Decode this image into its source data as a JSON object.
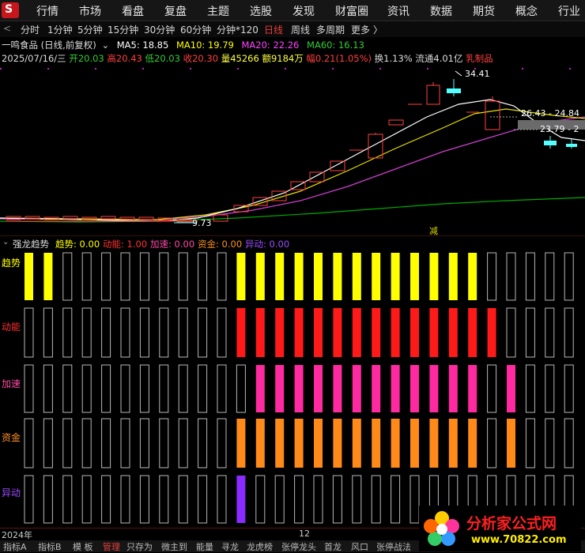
{
  "menu": [
    "行情",
    "市场",
    "看盘",
    "复盘",
    "主题",
    "选股",
    "发现",
    "财富圈",
    "资讯",
    "数据",
    "期货",
    "概念",
    "行业"
  ],
  "periods": [
    "分时",
    "1分钟",
    "5分钟",
    "15分钟",
    "30分钟",
    "60分钟",
    "分钟*120",
    "日线",
    "周线",
    "多周期",
    "更多"
  ],
  "active_period": "日线",
  "ma_line": {
    "stock": "一鸣食品 (日线,前复权)",
    "ma5": "MA5: 18.85",
    "ma10": "MA10: 19.79",
    "ma20": "MA20: 22.26",
    "ma60": "MA60: 16.13"
  },
  "quote_line": {
    "date": "2025/07/16/三",
    "open": "开20.03",
    "high": "高20.43",
    "low": "低20.03",
    "close": "收20.30",
    "volume": "量45266",
    "amount": "额9184万",
    "change": "幅0.21(1.05%)",
    "turnover": "换1.13%",
    "float_cap": "流通4.01亿",
    "sector": "乳制品"
  },
  "price_labels": {
    "high": "34.41",
    "low": "9.73",
    "mid1": "26.43 - 24.84",
    "mid2": "23.79 - 2",
    "marker": "减"
  },
  "chart_data": {
    "type": "candlestick",
    "high_label": 34.41,
    "low_label": 9.73,
    "ma_legend": [
      "MA5",
      "MA10",
      "MA20",
      "MA60"
    ]
  },
  "indicator": {
    "name": "强龙趋势",
    "trend": "趋势: 0.00",
    "momentum": "动能: 1.00",
    "accel": "加速: 0.00",
    "capital": "资金: 0.00",
    "abnormal": "异动: 0.00"
  },
  "row_labels": [
    "趋势",
    "动能",
    "加速",
    "资金",
    "异动"
  ],
  "axis_labels": {
    "left": "2024年",
    "mid": "12"
  },
  "bottom_tabs": [
    "指标A",
    "指标B",
    "模 板",
    "管理",
    "只存为",
    "微主到",
    "能量",
    "寻龙",
    "龙虎榜",
    "张停龙头",
    "首龙",
    "风口",
    "张停战法"
  ],
  "active_tab": "管理",
  "watermark": {
    "title": "分析家公式网",
    "url": "www.70822.com"
  },
  "colors": {
    "up": "#ff3232",
    "down": "#54ffff",
    "ma5": "#ffffff",
    "ma10": "#ffff00",
    "ma20": "#ff00ff",
    "ma60": "#00aa00"
  }
}
